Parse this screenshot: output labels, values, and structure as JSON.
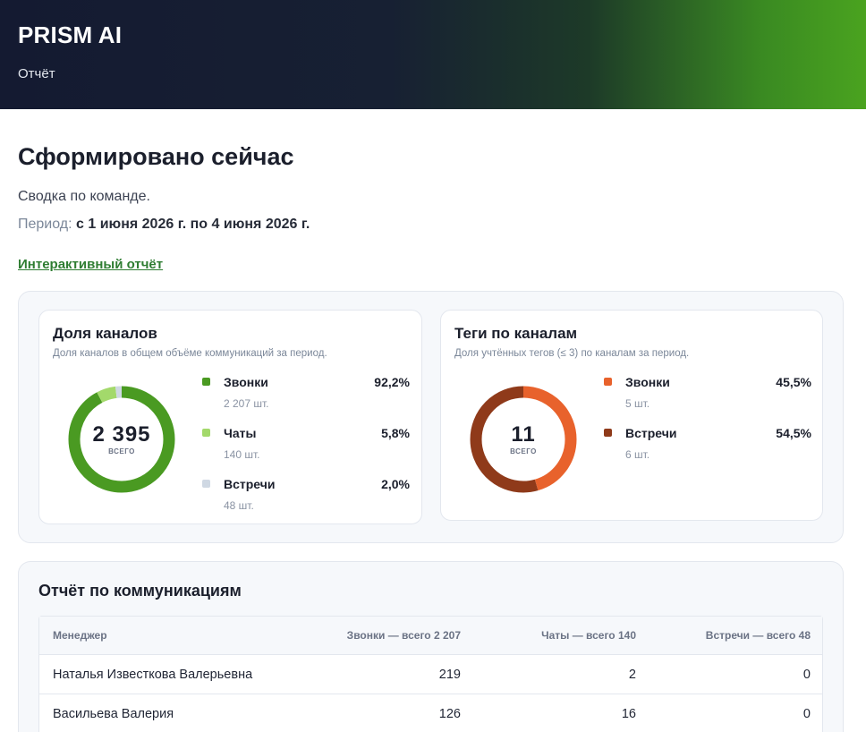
{
  "header": {
    "brand": "PRISM AI",
    "subtitle": "Отчёт"
  },
  "main": {
    "title": "Сформировано сейчас",
    "summary": "Сводка по команде.",
    "period_label": "Период:",
    "period_value": "с 1 июня 2026 г. по 4 июня 2026 г.",
    "link_text": "Интерактивный отчёт"
  },
  "channels": {
    "title": "Доля каналов",
    "description": "Доля каналов в общем объёме коммуникаций за период.",
    "total": "2 395",
    "total_label": "ВСЕГО",
    "items": [
      {
        "name": "Звонки",
        "pct": "92,2%",
        "count": "2 207 шт.",
        "share": 92.2,
        "color": "#4a9a22"
      },
      {
        "name": "Чаты",
        "pct": "5,8%",
        "count": "140 шт.",
        "share": 5.8,
        "color": "#a3d96b"
      },
      {
        "name": "Встречи",
        "pct": "2,0%",
        "count": "48 шт.",
        "share": 2.0,
        "color": "#cfd8e3"
      }
    ]
  },
  "tags": {
    "title": "Теги по каналам",
    "description": "Доля учтённых тегов (≤ 3) по каналам за период.",
    "total": "11",
    "total_label": "ВСЕГО",
    "items": [
      {
        "name": "Звонки",
        "pct": "45,5%",
        "count": "5 шт.",
        "share": 45.5,
        "color": "#e8622c"
      },
      {
        "name": "Встречи",
        "pct": "54,5%",
        "count": "6 шт.",
        "share": 54.5,
        "color": "#8f3a1a"
      }
    ]
  },
  "report": {
    "title": "Отчёт по коммуникациям",
    "columns": [
      "Менеджер",
      "Звонки — всего 2 207",
      "Чаты — всего 140",
      "Встречи — всего 48"
    ],
    "rows": [
      [
        "Наталья Известкова Валерьевна",
        "219",
        "2",
        "0"
      ],
      [
        "Васильева Валерия",
        "126",
        "16",
        "0"
      ]
    ]
  }
}
